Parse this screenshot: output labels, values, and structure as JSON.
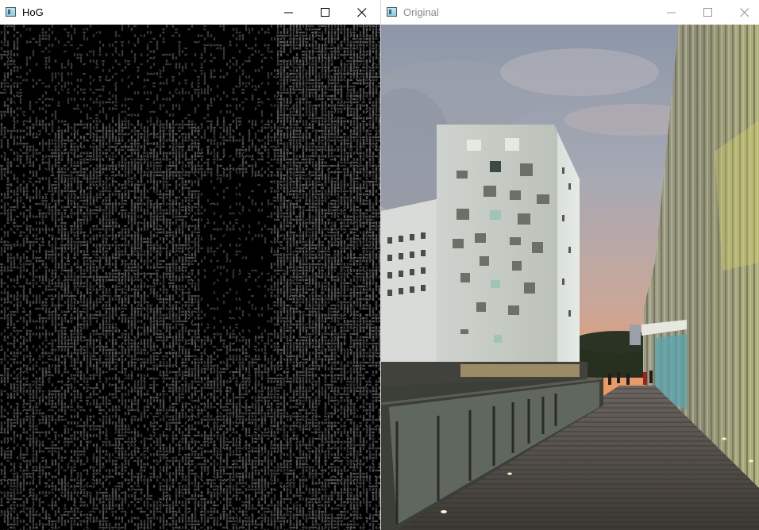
{
  "windows": {
    "hog": {
      "title": "HoG",
      "icon": "app-window-icon",
      "controls": [
        "minimize-icon",
        "maximize-icon",
        "close-icon"
      ]
    },
    "original": {
      "title": "Original",
      "icon": "app-window-icon",
      "controls": [
        "minimize-icon",
        "maximize-icon",
        "close-icon"
      ]
    }
  },
  "colors": {
    "titlebar_bg": "#ffffff",
    "active_title_text": "#000000",
    "inactive_title_text": "#8a8a8a",
    "sky_top": "#98a2b2",
    "sky_sunset": "#f08a4a",
    "building": "#d2d6d0",
    "hog_background": "#000000",
    "hog_lines": "#ffffff"
  }
}
